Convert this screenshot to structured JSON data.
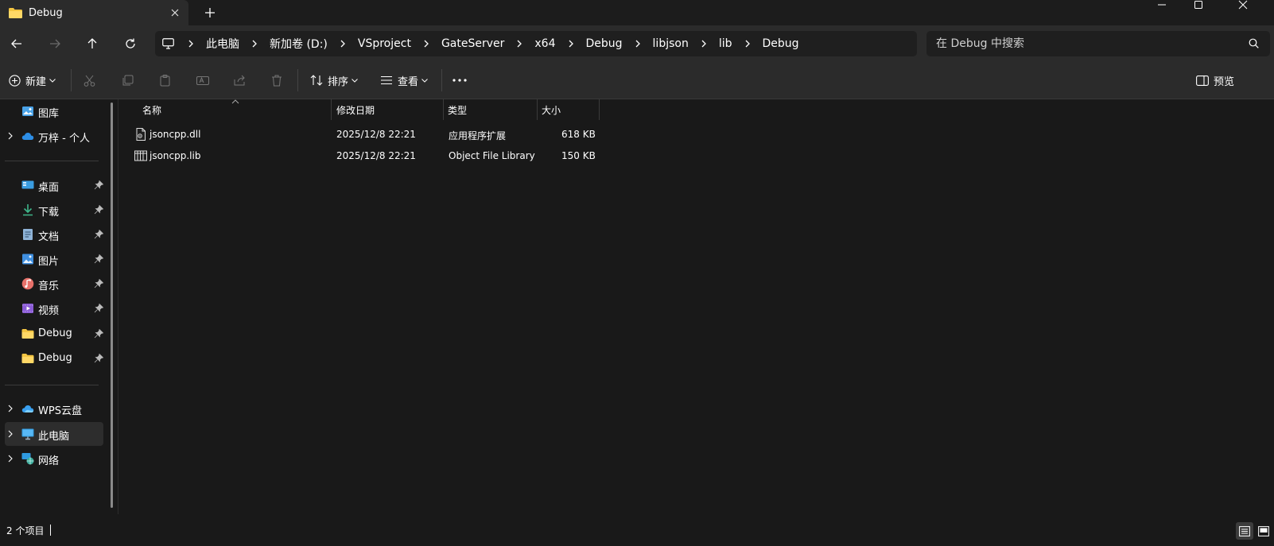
{
  "tab": {
    "title": "Debug"
  },
  "breadcrumb": [
    "此电脑",
    "新加卷 (D:)",
    "VSproject",
    "GateServer",
    "x64",
    "Debug",
    "libjson",
    "lib",
    "Debug"
  ],
  "search": {
    "placeholder": "在 Debug 中搜索"
  },
  "toolbar": {
    "new_label": "新建",
    "sort_label": "排序",
    "view_label": "查看",
    "preview_label": "预览"
  },
  "sidebar": {
    "top": [
      {
        "label": "图库",
        "icon": "gallery-icon"
      },
      {
        "label": "万梓 - 个人",
        "icon": "onedrive-cloud-icon"
      }
    ],
    "pinned": [
      {
        "label": "桌面",
        "icon": "desktop-icon"
      },
      {
        "label": "下载",
        "icon": "download-icon"
      },
      {
        "label": "文档",
        "icon": "documents-icon"
      },
      {
        "label": "图片",
        "icon": "pictures-icon"
      },
      {
        "label": "音乐",
        "icon": "music-icon"
      },
      {
        "label": "视频",
        "icon": "videos-icon"
      },
      {
        "label": "Debug",
        "icon": "folder-icon"
      },
      {
        "label": "Debug",
        "icon": "folder-icon"
      }
    ],
    "bottom": [
      {
        "label": "WPS云盘",
        "icon": "wps-cloud-icon"
      },
      {
        "label": "此电脑",
        "icon": "this-pc-icon"
      },
      {
        "label": "网络",
        "icon": "network-icon"
      }
    ]
  },
  "columns": {
    "name": "名称",
    "modified": "修改日期",
    "type": "类型",
    "size": "大小"
  },
  "files": [
    {
      "name": "jsoncpp.dll",
      "modified": "2025/12/8 22:21",
      "type": "应用程序扩展",
      "size": "618 KB",
      "icon": "dll-file-icon"
    },
    {
      "name": "jsoncpp.lib",
      "modified": "2025/12/8 22:21",
      "type": "Object File Library",
      "size": "150 KB",
      "icon": "lib-file-icon"
    }
  ],
  "status": {
    "count": "2 个项目"
  },
  "colors": {
    "background": "#191919",
    "chrome": "#2b2b2b",
    "folder": "#f4c542",
    "accent": "#4cc2ff"
  }
}
